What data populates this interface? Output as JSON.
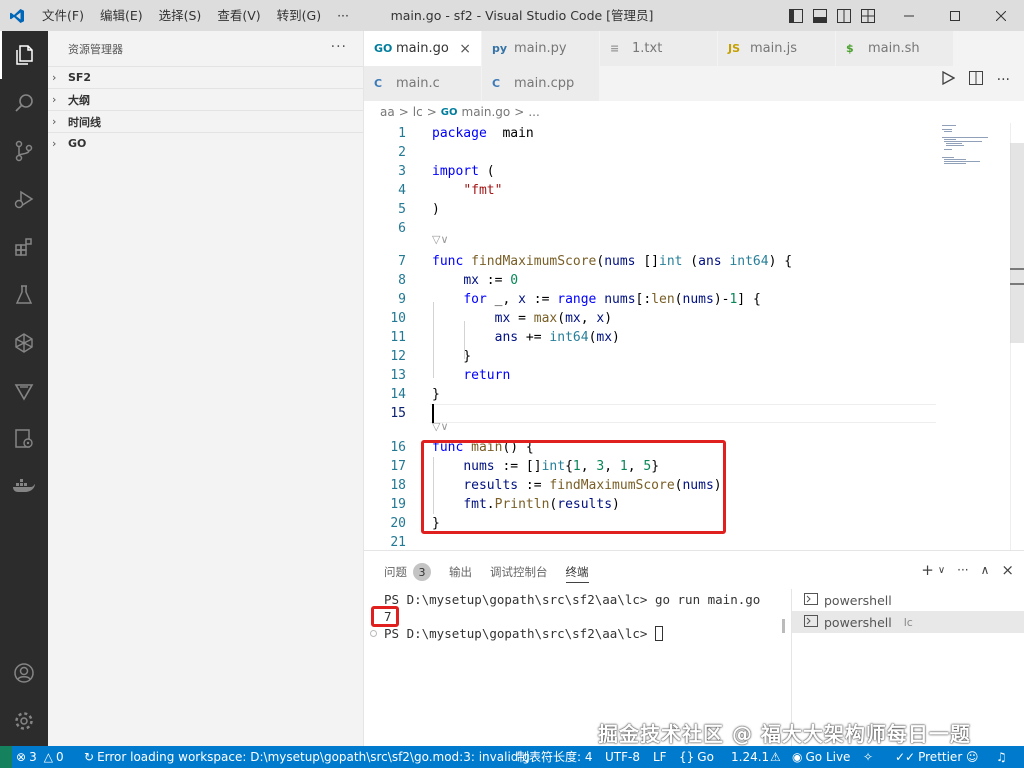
{
  "titlebar": {
    "menu": [
      "文件(F)",
      "编辑(E)",
      "选择(S)",
      "查看(V)",
      "转到(G)",
      "···"
    ],
    "title": "main.go - sf2 - Visual Studio Code [管理员]"
  },
  "sidebar": {
    "title": "资源管理器",
    "more": "···",
    "sections": [
      "SF2",
      "大纲",
      "时间线",
      "GO"
    ]
  },
  "tabs": {
    "row1": [
      {
        "label": "main.go",
        "icon": "GO",
        "color": "#007d9c",
        "active": true
      },
      {
        "label": "main.py",
        "icon": "py",
        "color": "#3572a5",
        "active": false
      },
      {
        "label": "1.txt",
        "icon": "≡",
        "color": "#999999",
        "active": false
      },
      {
        "label": "main.js",
        "icon": "JS",
        "color": "#c4a000",
        "active": false
      },
      {
        "label": "main.sh",
        "icon": "$",
        "color": "#4aa02c",
        "active": false
      }
    ],
    "row2": [
      {
        "label": "main.c",
        "icon": "C",
        "color": "#3d7ab8",
        "active": false
      },
      {
        "label": "main.cpp",
        "icon": "C",
        "color": "#3d7ab8",
        "active": false
      }
    ],
    "close": "×"
  },
  "breadcrumb": {
    "parts": [
      "aa",
      ">",
      "lc",
      ">",
      "GO",
      "main.go",
      ">",
      "..."
    ]
  },
  "editor": {
    "lines": [
      {
        "n": "1",
        "tokens": [
          [
            "kw",
            "package"
          ],
          [
            "",
            "  "
          ],
          [
            "",
            "main"
          ]
        ]
      },
      {
        "n": "2",
        "tokens": []
      },
      {
        "n": "3",
        "tokens": [
          [
            "kw",
            "import"
          ],
          [
            "",
            " ("
          ]
        ]
      },
      {
        "n": "4",
        "tokens": [
          [
            "",
            "    "
          ],
          [
            "str",
            "\"fmt\""
          ]
        ]
      },
      {
        "n": "5",
        "tokens": [
          [
            "",
            ")"
          ]
        ]
      },
      {
        "n": "6",
        "tokens": []
      },
      {
        "n": "7",
        "tokens": [
          [
            "kw",
            "func"
          ],
          [
            "",
            " "
          ],
          [
            "fn",
            "findMaximumScore"
          ],
          [
            "",
            "("
          ],
          [
            "var",
            "nums"
          ],
          [
            "",
            " []"
          ],
          [
            "ty",
            "int"
          ],
          [
            "",
            " ("
          ],
          [
            "var",
            "ans"
          ],
          [
            "",
            " "
          ],
          [
            "ty",
            "int64"
          ],
          [
            "",
            ") {"
          ]
        ]
      },
      {
        "n": "8",
        "tokens": [
          [
            "",
            "    "
          ],
          [
            "var",
            "mx"
          ],
          [
            "",
            " := "
          ],
          [
            "num",
            "0"
          ]
        ]
      },
      {
        "n": "9",
        "tokens": [
          [
            "",
            "    "
          ],
          [
            "kw",
            "for"
          ],
          [
            "",
            " _, "
          ],
          [
            "var",
            "x"
          ],
          [
            "",
            " := "
          ],
          [
            "kw",
            "range"
          ],
          [
            "",
            " "
          ],
          [
            "var",
            "nums"
          ],
          [
            "",
            "[:"
          ],
          [
            "fn",
            "len"
          ],
          [
            "",
            "("
          ],
          [
            "var",
            "nums"
          ],
          [
            "",
            ")-"
          ],
          [
            "num",
            "1"
          ],
          [
            "",
            "] {"
          ]
        ]
      },
      {
        "n": "10",
        "tokens": [
          [
            "",
            "        "
          ],
          [
            "var",
            "mx"
          ],
          [
            "",
            " = "
          ],
          [
            "fn",
            "max"
          ],
          [
            "",
            "("
          ],
          [
            "var",
            "mx"
          ],
          [
            "",
            ", "
          ],
          [
            "var",
            "x"
          ],
          [
            "",
            ")"
          ]
        ]
      },
      {
        "n": "11",
        "tokens": [
          [
            "",
            "        "
          ],
          [
            "var",
            "ans"
          ],
          [
            "",
            " += "
          ],
          [
            "ty",
            "int64"
          ],
          [
            "",
            "("
          ],
          [
            "var",
            "mx"
          ],
          [
            "",
            ")"
          ]
        ]
      },
      {
        "n": "12",
        "tokens": [
          [
            "",
            "    }"
          ]
        ]
      },
      {
        "n": "13",
        "tokens": [
          [
            "",
            "    "
          ],
          [
            "kw",
            "return"
          ]
        ]
      },
      {
        "n": "14",
        "tokens": [
          [
            "",
            "}"
          ]
        ]
      },
      {
        "n": "15",
        "tokens": []
      },
      {
        "n": "16",
        "tokens": [
          [
            "kw",
            "func"
          ],
          [
            "",
            " "
          ],
          [
            "fn",
            "main"
          ],
          [
            "",
            "() {"
          ]
        ]
      },
      {
        "n": "17",
        "tokens": [
          [
            "",
            "    "
          ],
          [
            "var",
            "nums"
          ],
          [
            "",
            " := []"
          ],
          [
            "ty",
            "int"
          ],
          [
            "",
            "{"
          ],
          [
            "num",
            "1"
          ],
          [
            "",
            ", "
          ],
          [
            "num",
            "3"
          ],
          [
            "",
            ", "
          ],
          [
            "num",
            "1"
          ],
          [
            "",
            ", "
          ],
          [
            "num",
            "5"
          ],
          [
            "",
            "}"
          ]
        ]
      },
      {
        "n": "18",
        "tokens": [
          [
            "",
            "    "
          ],
          [
            "var",
            "results"
          ],
          [
            "",
            " := "
          ],
          [
            "fn",
            "findMaximumScore"
          ],
          [
            "",
            "("
          ],
          [
            "var",
            "nums"
          ],
          [
            "",
            ")"
          ]
        ]
      },
      {
        "n": "19",
        "tokens": [
          [
            "",
            "    "
          ],
          [
            "var",
            "fmt"
          ],
          [
            "",
            "."
          ],
          [
            "fn",
            "Println"
          ],
          [
            "",
            "("
          ],
          [
            "var",
            "results"
          ],
          [
            "",
            ")"
          ]
        ]
      },
      {
        "n": "20",
        "tokens": [
          [
            "",
            "}"
          ]
        ]
      },
      {
        "n": "21",
        "tokens": []
      }
    ],
    "codelens": "▽∨"
  },
  "panel": {
    "tabs": [
      {
        "label": "问题",
        "badge": "3"
      },
      {
        "label": "输出"
      },
      {
        "label": "调试控制台"
      },
      {
        "label": "终端",
        "active": true
      }
    ],
    "terminal": {
      "line1_prompt": "PS D:\\mysetup\\gopath\\src\\sf2\\aa\\lc> ",
      "line1_cmd": "go run main.go",
      "output": "7",
      "line3_prompt": "PS D:\\mysetup\\gopath\\src\\sf2\\aa\\lc> "
    },
    "terminals": [
      {
        "label": "powershell",
        "sub": ""
      },
      {
        "label": "powershell",
        "sub": "lc"
      }
    ]
  },
  "watermark": "掘金技术社区 @ 福大大架构师每日一题",
  "statusbar": {
    "errors": "3",
    "warnings": "0",
    "message": "Error loading workspace: D:\\mysetup\\gopath\\src\\sf2\\go.mod:3: invalid g",
    "tabsize": "制表符长度: 4",
    "encoding": "UTF-8",
    "eol": "LF",
    "language": "Go",
    "goversion": "1.24.1",
    "golive": "Go Live",
    "prettier": "Prettier"
  }
}
